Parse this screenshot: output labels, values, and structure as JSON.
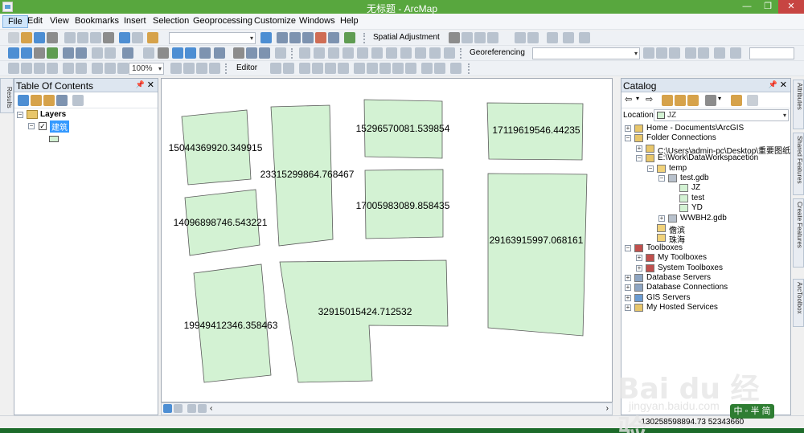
{
  "window": {
    "title": "无标题 - ArcMap",
    "minimize_label": "—",
    "maximize_label": "❐",
    "close_label": "✕"
  },
  "menu": [
    "File",
    "Edit",
    "View",
    "Bookmarks",
    "Insert",
    "Selection",
    "Geoprocessing",
    "Customize",
    "Windows",
    "Help"
  ],
  "toolbars": {
    "spatial_adjustment": "Spatial Adjustment",
    "georeferencing": "Georeferencing",
    "editor": "Editor",
    "zoom_value": "100%"
  },
  "toc": {
    "title": "Table Of Contents",
    "side_tab": "Results",
    "root": "Layers",
    "layer": "建筑",
    "layer_checked": true
  },
  "map": {
    "fill_color": "#d3f2d3",
    "stroke_color": "#5a5a5a",
    "labels": [
      "15044369920.349915",
      "23315299864.768467",
      "15296570081.539854",
      "17119619546.44235",
      "14096898746.543221",
      "17005983089.858435",
      "29163915997.068161",
      "19949412346.358463",
      "32915015424.712532"
    ]
  },
  "catalog": {
    "title": "Catalog",
    "location_label": "Location:",
    "location_value": "JZ",
    "items": [
      {
        "label": "Home - Documents\\ArcGIS",
        "level": 0,
        "icon": "folder-home-icon"
      },
      {
        "label": "Folder Connections",
        "level": 0,
        "icon": "folder-connection-icon"
      },
      {
        "label": "C:\\Users\\admin-pc\\Desktop\\重要图纸",
        "level": 1,
        "icon": "folder-connection-icon"
      },
      {
        "label": "E:\\Work\\DataWorkspacetion",
        "level": 1,
        "icon": "folder-connection-icon"
      },
      {
        "label": "temp",
        "level": 2,
        "icon": "folder-icon"
      },
      {
        "label": "test.gdb",
        "level": 3,
        "icon": "geodatabase-icon"
      },
      {
        "label": "JZ",
        "level": 4,
        "icon": "feature-class-icon"
      },
      {
        "label": "test",
        "level": 4,
        "icon": "feature-class-icon"
      },
      {
        "label": "YD",
        "level": 4,
        "icon": "feature-class-icon"
      },
      {
        "label": "WWBH2.gdb",
        "level": 3,
        "icon": "geodatabase-icon"
      },
      {
        "label": "儋滨",
        "level": 2,
        "icon": "folder-icon"
      },
      {
        "label": "珠海",
        "level": 2,
        "icon": "folder-icon"
      },
      {
        "label": "Toolboxes",
        "level": 0,
        "icon": "toolbox-icon"
      },
      {
        "label": "My Toolboxes",
        "level": 1,
        "icon": "toolbox-icon"
      },
      {
        "label": "System Toolboxes",
        "level": 1,
        "icon": "toolbox-icon"
      },
      {
        "label": "Database Servers",
        "level": 0,
        "icon": "database-server-icon"
      },
      {
        "label": "Database Connections",
        "level": 0,
        "icon": "database-connection-icon"
      },
      {
        "label": "GIS Servers",
        "level": 0,
        "icon": "gis-server-icon"
      },
      {
        "label": "My Hosted Services",
        "level": 0,
        "icon": "hosted-services-icon"
      }
    ]
  },
  "right_tabs": [
    "Attributes",
    "Shared Features",
    "Create Features",
    "ArcToolbox"
  ],
  "status": {
    "coordinates": "-130258598894.73  52343660"
  },
  "watermark": {
    "main": "Bai du 经验",
    "sub": "jingyan.baidu.com",
    "badge": "中 ◦ 半 简"
  }
}
